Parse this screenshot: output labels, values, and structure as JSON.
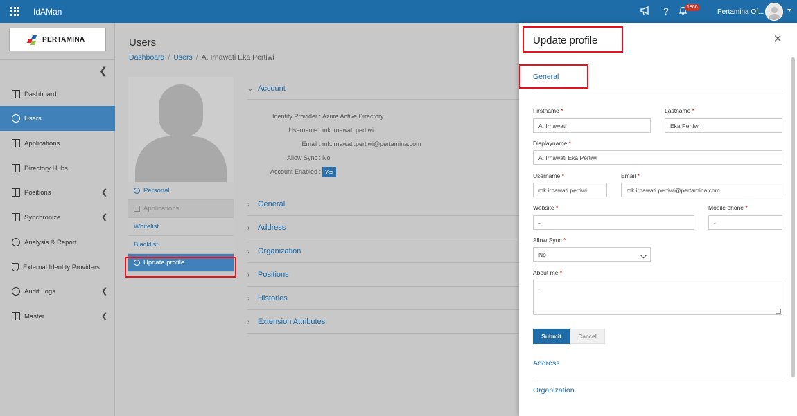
{
  "app": {
    "title": "IdAMan"
  },
  "topbar": {
    "notif_count": "1866",
    "user_name": "Pertamina Of..."
  },
  "logo": {
    "text": "PERTAMINA",
    "colors": [
      "#e3262b",
      "#1a61a6",
      "#8dc63f"
    ]
  },
  "sidebar": {
    "items": [
      {
        "label": "Dashboard",
        "icon": "dashboard-icon"
      },
      {
        "label": "Users",
        "icon": "users-icon",
        "active": true
      },
      {
        "label": "Applications",
        "icon": "applications-icon"
      },
      {
        "label": "Directory Hubs",
        "icon": "directory-icon"
      },
      {
        "label": "Positions",
        "icon": "positions-icon",
        "expandable": true
      },
      {
        "label": "Synchronize",
        "icon": "sync-icon",
        "expandable": true
      },
      {
        "label": "Analysis & Report",
        "icon": "report-icon"
      },
      {
        "label": "External Identity Providers",
        "icon": "shield-icon"
      },
      {
        "label": "Audit Logs",
        "icon": "history-icon",
        "expandable": true
      },
      {
        "label": "Master",
        "icon": "master-icon",
        "expandable": true
      }
    ]
  },
  "page": {
    "title": "Users",
    "breadcrumb": [
      "Dashboard",
      "Users",
      "A. Irnawati Eka Pertiwi"
    ]
  },
  "profile_menu": [
    {
      "label": "Personal",
      "state": "normal"
    },
    {
      "label": "Applications",
      "state": "disabled"
    },
    {
      "label": "Whitelist",
      "state": "normal"
    },
    {
      "label": "Blacklist",
      "state": "normal"
    },
    {
      "label": "Update profile",
      "state": "active"
    }
  ],
  "account": {
    "title": "Account",
    "rows": [
      {
        "key": "Identity Provider :",
        "value": "Azure Active Directory"
      },
      {
        "key": "Username :",
        "value": "mk.irnawati.pertiwi"
      },
      {
        "key": "Email :",
        "value": "mk.irnawati.pertiwi@pertamina.com"
      },
      {
        "key": "Allow Sync :",
        "value": "No"
      }
    ],
    "enabled_key": "Account Enabled :",
    "enabled_value": "Yes"
  },
  "sections": [
    "General",
    "Address",
    "Organization",
    "Positions",
    "Histories",
    "Extension Attributes"
  ],
  "panel": {
    "title": "Update profile",
    "tab": "General",
    "fields": {
      "firstname": {
        "label": "Firstname",
        "value": "A. Irnawati"
      },
      "lastname": {
        "label": "Lastname",
        "value": "Eka Pertiwi"
      },
      "displayname": {
        "label": "Displayname",
        "value": "A. Irnawati Eka Pertiwi"
      },
      "username": {
        "label": "Username",
        "value": "mk.irnawati.pertiwi"
      },
      "email": {
        "label": "Email",
        "value": "mk.irnawati.pertiwi@pertamina.com"
      },
      "website": {
        "label": "Website",
        "value": "-"
      },
      "mobile": {
        "label": "Mobile phone",
        "value": "-"
      },
      "allow_sync": {
        "label": "Allow Sync",
        "value": "No"
      },
      "about": {
        "label": "About me",
        "value": "-"
      }
    },
    "required_mark": "*",
    "submit": "Submit",
    "cancel": "Cancel",
    "sections": [
      "Address",
      "Organization"
    ]
  }
}
